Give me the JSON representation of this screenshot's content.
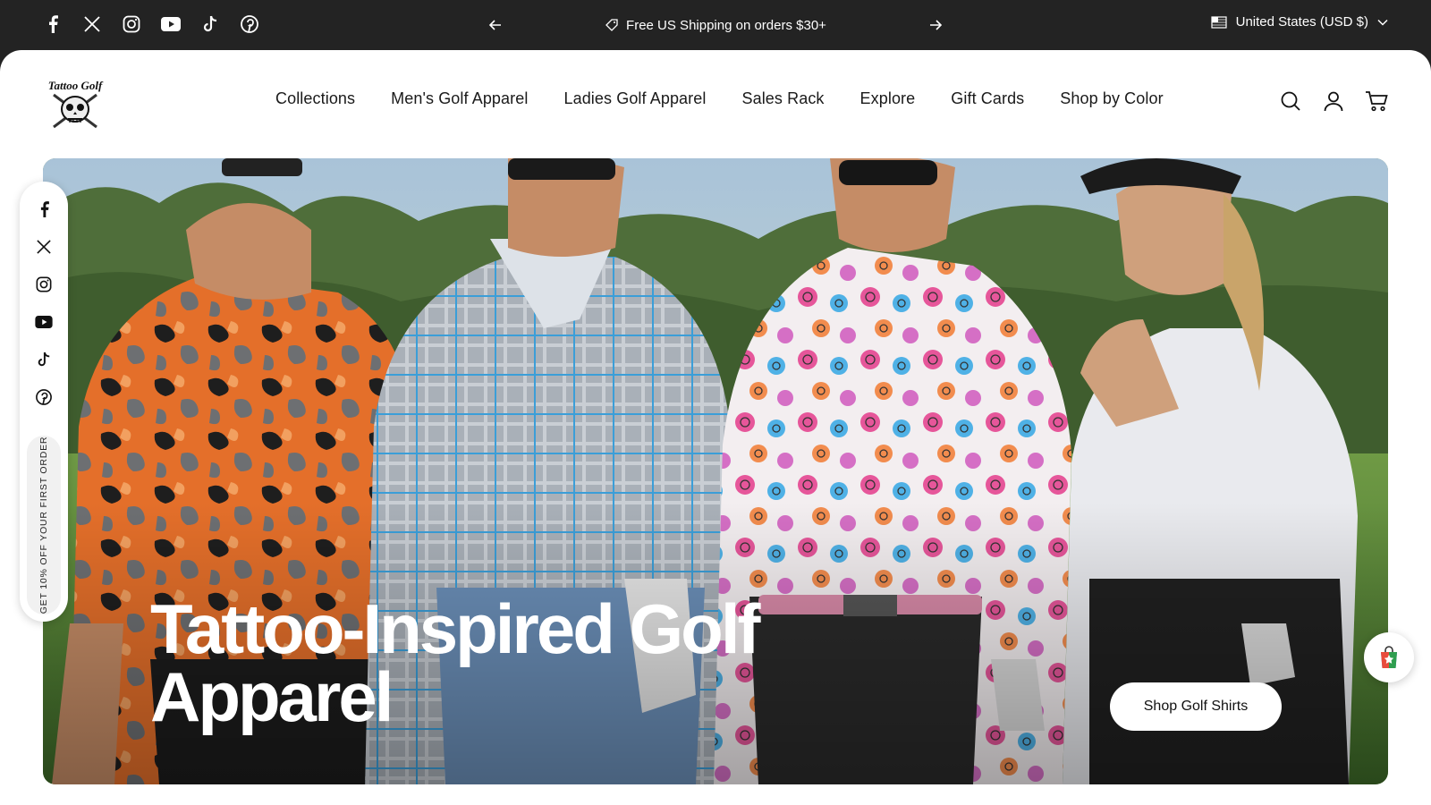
{
  "topbar": {
    "socials": [
      "facebook-icon",
      "x-icon",
      "instagram-icon",
      "youtube-icon",
      "tiktok-icon",
      "pinterest-icon"
    ],
    "announcement": "Free US Shipping on orders $30+",
    "locale": "United States (USD $)"
  },
  "header": {
    "logo_text": "Tattoo Golf",
    "nav": [
      "Collections",
      "Men's Golf Apparel",
      "Ladies Golf Apparel",
      "Sales Rack",
      "Explore",
      "Gift Cards",
      "Shop by Color"
    ],
    "icons": [
      "search-icon",
      "account-icon",
      "cart-icon"
    ]
  },
  "hero": {
    "title": "Tattoo-Inspired Golf Apparel",
    "cta": "Shop Golf Shirts"
  },
  "rail": {
    "socials": [
      "facebook-icon",
      "x-icon",
      "instagram-icon",
      "youtube-icon",
      "tiktok-icon",
      "pinterest-icon"
    ],
    "promo": "GET 10% OFF YOUR FIRST ORDER"
  },
  "colors": {
    "topbar_bg": "#232323",
    "page_bg": "#ffffff",
    "text": "#1a1a1a",
    "button_bg": "#ffffff"
  }
}
